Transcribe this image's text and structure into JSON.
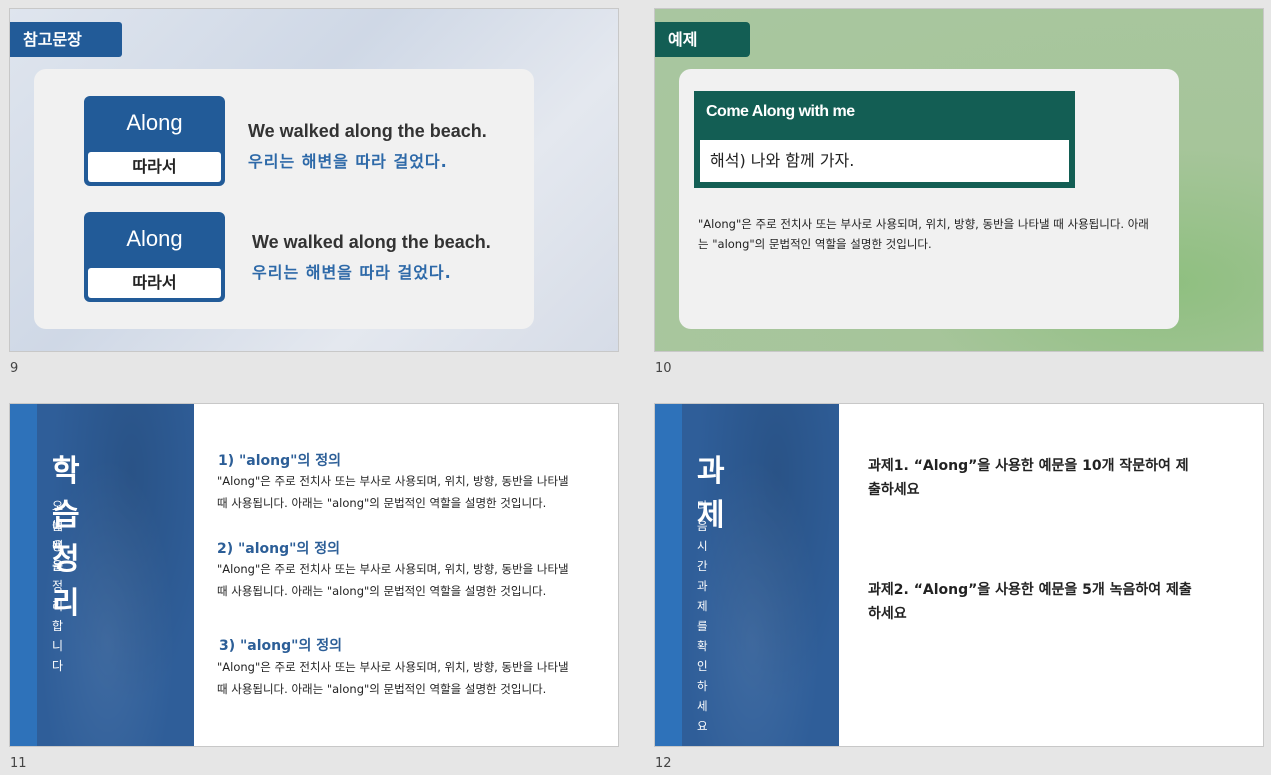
{
  "slides": [
    {
      "number": "9",
      "tag": "참고문장",
      "entries": [
        {
          "word": "Along",
          "meaning": "따라서",
          "en": "We walked along the beach.",
          "ko": "우리는 해변을 따라 걸었다."
        },
        {
          "word": "Along",
          "meaning": "따라서",
          "en": "We walked along the beach.",
          "ko": "우리는 해변을 따라 걸었다."
        }
      ]
    },
    {
      "number": "10",
      "tag": "예제",
      "example_title": "Come Along with me",
      "example_translation": "해석) 나와 함께 가자.",
      "description": "\"Along\"은 주로 전치사 또는 부사로 사용되며, 위치, 방향, 동반을 나타낼 때 사용됩니다. 아래는 \"along\"의 문법적인 역할을 설명한 것입니다."
    },
    {
      "number": "11",
      "title": "학습정리",
      "subtitle_line1": "오늘 배운",
      "subtitle_line2": "내용을 정리합니다",
      "items": [
        {
          "heading": "1) \"along\"의 정의",
          "body": "\"Along\"은 주로 전치사 또는 부사로 사용되며, 위치, 방향, 동반을 나타낼 때 사용됩니다. 아래는 \"along\"의 문법적인 역할을 설명한 것입니다."
        },
        {
          "heading": "2) \"along\"의 정의",
          "body": "\"Along\"은 주로 전치사 또는 부사로 사용되며, 위치, 방향, 동반을 나타낼 때 사용됩니다. 아래는 \"along\"의 문법적인 역할을 설명한 것입니다."
        },
        {
          "heading": "3) \"along\"의 정의",
          "body": "\"Along\"은 주로 전치사 또는 부사로 사용되며, 위치, 방향, 동반을 나타낼 때 사용됩니다. 아래는 \"along\"의 문법적인 역할을 설명한 것입니다."
        }
      ]
    },
    {
      "number": "12",
      "title": "과제",
      "subtitle": "다음시간 과제를 확인하세요",
      "tasks": [
        "과제1. “Along”을 사용한 예문을 10개 작문하여 제출하세요",
        "과제2. “Along”을 사용한 예문을 5개 녹음하여 제출하세요"
      ]
    }
  ],
  "colors": {
    "accent_blue": "#225b98",
    "accent_green": "#135e54",
    "panel_blue": "#2f5e99"
  }
}
